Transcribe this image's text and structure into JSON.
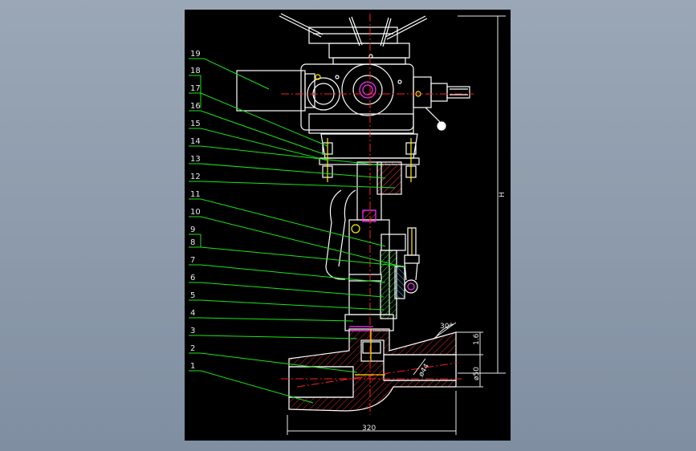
{
  "drawing": {
    "part_numbers": [
      "1",
      "2",
      "3",
      "4",
      "5",
      "6",
      "7",
      "8",
      "9",
      "10",
      "11",
      "12",
      "13",
      "14",
      "15",
      "16",
      "17",
      "18",
      "19"
    ],
    "dimensions": {
      "width": "320",
      "height": "H",
      "angle": "30°",
      "wall": "1.6",
      "bore": "ø50",
      "inner": "ø44"
    }
  },
  "colors": {
    "sheet": "#000000",
    "outline": "#ffffff",
    "leader": "#19e619",
    "centerline": "#ff2020",
    "hatch": "#ff3030",
    "hatch_alt": "#30d0ff",
    "magenta": "#ff33ff",
    "yellow": "#ffee00"
  }
}
